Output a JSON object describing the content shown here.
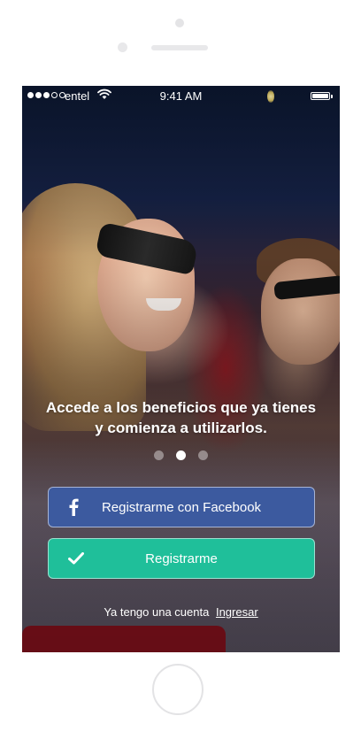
{
  "status_bar": {
    "carrier": "entel",
    "time": "9:41 AM",
    "signal_dots_filled": 3,
    "signal_dots_total": 5
  },
  "onboarding": {
    "tagline": "Accede a los beneficios que ya tienes y comienza a utilizarlos.",
    "page_count": 3,
    "active_page": 2
  },
  "buttons": {
    "facebook_label": "Registrarme con Facebook",
    "register_label": "Registrarme"
  },
  "login": {
    "prompt": "Ya tengo una cuenta",
    "link_label": "Ingresar"
  },
  "colors": {
    "facebook": "#3c5a9f",
    "register": "#1fbf9a"
  },
  "icons": {
    "facebook": "facebook-icon",
    "register": "checkmark-icon",
    "wifi": "wifi-icon",
    "battery": "battery-icon"
  }
}
